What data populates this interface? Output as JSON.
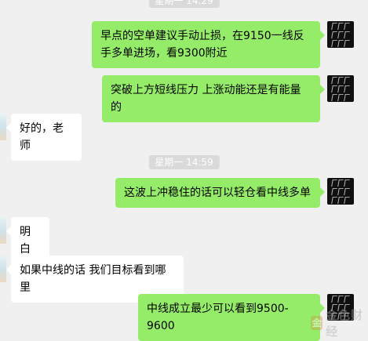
{
  "chat": {
    "timestamps": {
      "t1": "星期一 14:29",
      "t2": "星期一 14:59"
    },
    "messages": [
      {
        "sender": "self",
        "text": "早点的空单建议手动止损，在9150一线反手多单进场，看9300附近"
      },
      {
        "sender": "self",
        "text": "突破上方短线压力 上涨动能还是有能量的"
      },
      {
        "sender": "other",
        "text": "好的，老师"
      },
      {
        "sender": "self",
        "text": "这波上冲稳住的话可以轻仓看中线多单"
      },
      {
        "sender": "other",
        "text": "明白"
      },
      {
        "sender": "other",
        "text": "如果中线的话 我们目标看到哪里"
      },
      {
        "sender": "self",
        "text": "中线成立最少可以看到9500-9600"
      }
    ]
  },
  "watermark": {
    "mark": "金",
    "text": "金色财经"
  }
}
